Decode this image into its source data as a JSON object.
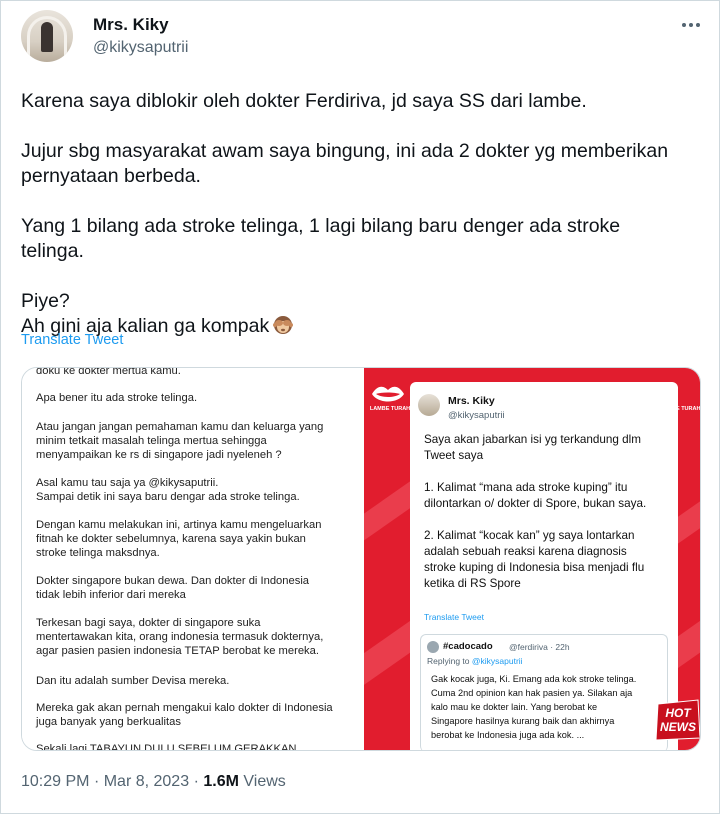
{
  "tweet": {
    "author_name": "Mrs. Kiky",
    "author_handle": "@kikysaputrii",
    "paragraphs": [
      "Karena saya diblokir oleh dokter Ferdiriva, jd saya SS dari lambe.",
      "Jujur sbg masyarakat awam saya bingung, ini ada 2 dokter yg memberikan pernyataan berbeda.",
      "Yang 1 bilang ada stroke telinga, 1 lagi bilang baru denger ada stroke telinga."
    ],
    "line_piye": "Piye?",
    "line_last": "Ah gini aja kalian ga kompak",
    "emoji_icon": "see-no-evil-monkey-icon",
    "translate_label": "Translate Tweet",
    "time": "10:29 PM",
    "separator": "·",
    "date": "Mar 8, 2023",
    "views_count": "1.6M",
    "views_label": "Views"
  },
  "media": {
    "left_lines": [
      "doku ke dokter mertua kamu.",
      "Apa bener itu ada stroke telinga.",
      "Atau jangan jangan pemahaman kamu dan keluarga yang",
      "minim tetkait masalah telinga mertua sehingga",
      "menyampaikan ke rs di singapore jadi nyeleneh ?",
      "Asal kamu tau saja ya @kikysaputrii.",
      "Sampai detik ini saya baru dengar ada stroke telinga.",
      "Dengan kamu melakukan ini, artinya kamu mengeluarkan",
      "fitnah ke dokter sebelumnya, karena saya yakin bukan",
      "stroke telinga maksdnya.",
      "Dokter singapore bukan dewa. Dan dokter di Indonesia",
      "tidak lebih inferior dari mereka",
      "Terkesan bagi saya, dokter di singapore suka",
      "mentertawakan kita, orang indonesia termasuk dokternya,",
      "agar pasien pasien indonesia TETAP berobat ke mereka.",
      "Dan itu adalah sumber Devisa mereka.",
      "Mereka gak akan pernah mengakui kalo dokter di Indonesia",
      "juga banyak yang berkualitas",
      "Sekali lagi TABAYUN DULU SEBELUM GERAKKAN"
    ],
    "brand_left": "LAMBE TURAH",
    "brand_right": "E TURAH",
    "card": {
      "name": "Mrs. Kiky",
      "handle": "@kikysaputrii",
      "lines": [
        "Saya akan jabarkan isi yg terkandung dlm",
        "Tweet saya",
        "1. Kalimat “mana ada stroke kuping” itu",
        "dilontarkan o/ dokter di Spore, bukan saya.",
        "2. Kalimat “kocak kan” yg saya lontarkan",
        "adalah sebuah reaksi karena diagnosis",
        "stroke kuping di Indonesia bisa menjadi flu",
        "ketika di RS Spore"
      ],
      "translate_label": "Translate Tweet",
      "quote": {
        "name": "#cadocado",
        "handle": "@ferdiriva · 22h",
        "reply_prefix": "Replying to",
        "reply_handle": "@kikysaputrii",
        "lines": [
          "Gak kocak juga, Ki. Emang ada kok stroke telinga.",
          "Cuma 2nd opinion kan hak pasien ya. Silakan aja",
          "kalo mau ke dokter lain. Yang berobat ke",
          "Singapore hasilnya kurang baik dan akhirnya",
          "berobat ke Indonesia juga ada kok. ..."
        ]
      }
    },
    "hot_news_line1": "HOT",
    "hot_news_line2": "NEWS"
  },
  "colors": {
    "accent_blue": "#1d9bf0",
    "secondary_text": "#536471",
    "media_red": "#e11d2e"
  }
}
